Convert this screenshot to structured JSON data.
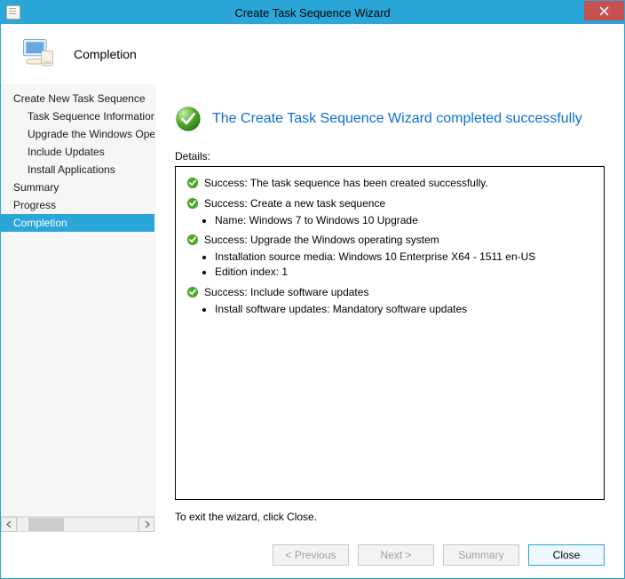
{
  "window": {
    "title": "Create Task Sequence Wizard"
  },
  "header": {
    "step": "Completion"
  },
  "sidebar": {
    "items": [
      {
        "label": "Create New Task Sequence",
        "indent": 0
      },
      {
        "label": "Task Sequence Information",
        "indent": 1
      },
      {
        "label": "Upgrade the Windows Operating System",
        "indent": 1
      },
      {
        "label": "Include Updates",
        "indent": 1
      },
      {
        "label": "Install Applications",
        "indent": 1
      },
      {
        "label": "Summary",
        "indent": 0
      },
      {
        "label": "Progress",
        "indent": 0
      },
      {
        "label": "Completion",
        "indent": 0,
        "selected": true
      }
    ]
  },
  "main": {
    "heading": "The Create Task Sequence Wizard completed successfully",
    "details_label": "Details:",
    "details": [
      {
        "text": "Success: The task sequence has been created successfully.",
        "bullets": []
      },
      {
        "text": "Success: Create a new task sequence",
        "bullets": [
          "Name: Windows 7 to Windows 10 Upgrade"
        ]
      },
      {
        "text": "Success: Upgrade the Windows operating system",
        "bullets": [
          "Installation source media:  Windows 10 Enterprise X64 - 1511 en-US",
          "Edition index: 1"
        ]
      },
      {
        "text": "Success: Include software updates",
        "bullets": [
          "Install software updates: Mandatory software updates"
        ]
      }
    ],
    "exit_hint": "To exit the wizard, click Close."
  },
  "footer": {
    "previous": "< Previous",
    "next": "Next >",
    "summary": "Summary",
    "close": "Close"
  }
}
